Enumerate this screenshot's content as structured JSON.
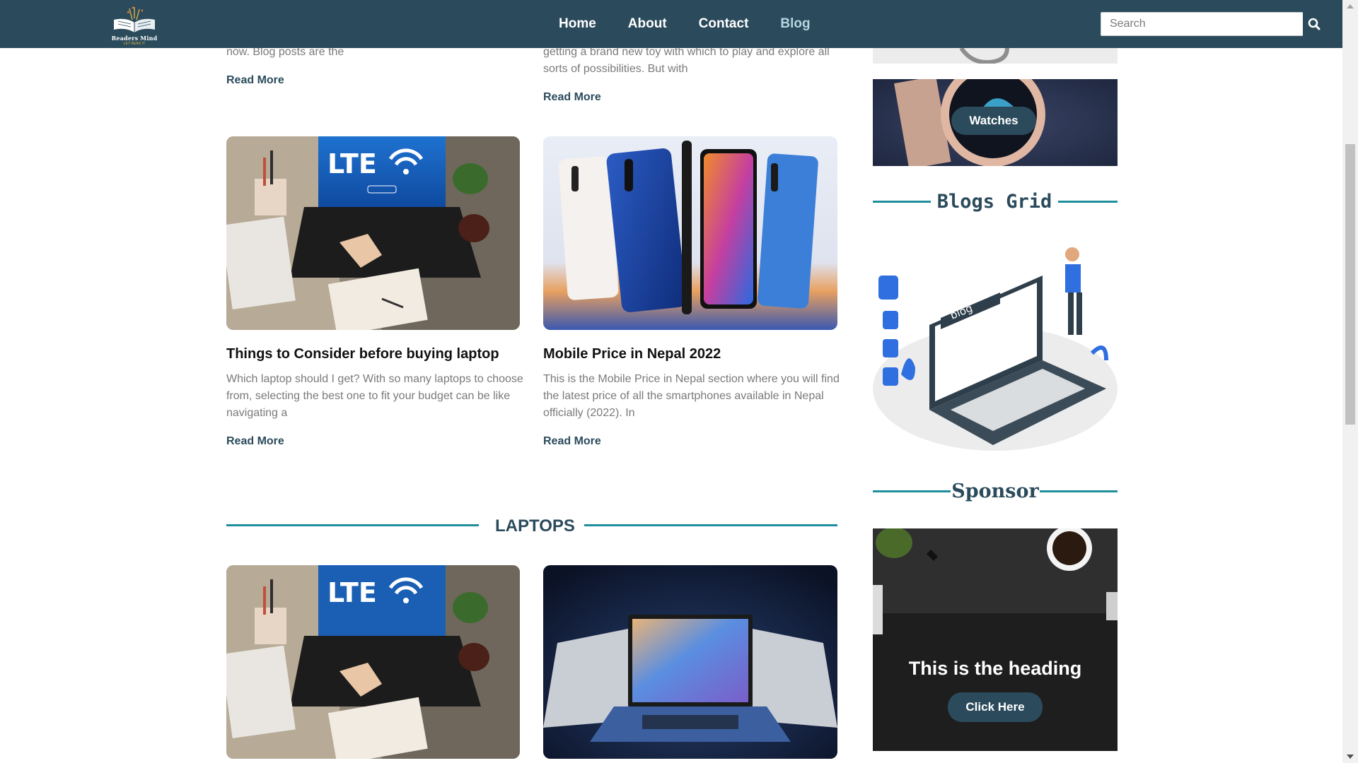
{
  "nav": {
    "logo_text": "Readers Mind",
    "logo_sub": "LET READ IT",
    "links": [
      {
        "label": "Home"
      },
      {
        "label": "About"
      },
      {
        "label": "Contact"
      },
      {
        "label": "Blog"
      }
    ],
    "search_placeholder": "Search"
  },
  "top_posts": [
    {
      "snippet": "now. Blog posts are the",
      "read_more": "Read More"
    },
    {
      "snippet_lines": [
        "getting a brand new toy with which to play and explore all",
        "sorts of possibilities. But with"
      ],
      "read_more": "Read More"
    }
  ],
  "posts": [
    {
      "title": "Things to Consider before buying laptop",
      "snippet_lines": [
        "Which laptop should I get? With so many laptops to choose",
        "from, selecting the best one to fit your budget can be like",
        "navigating a"
      ],
      "read_more": "Read More",
      "image_text": "LTE"
    },
    {
      "title": "Mobile Price in Nepal 2022",
      "snippet_lines": [
        "This is the Mobile Price in Nepal section where you will find",
        "the latest price of all the smartphones available in Nepal",
        "officially (2022). In"
      ],
      "read_more": "Read More"
    }
  ],
  "laptops_section": {
    "title": "LAPTOPS",
    "image_text": "LTE"
  },
  "sidebar": {
    "watches_label": "Watches",
    "blogs_grid_title": "Blogs Grid",
    "blog_illustration_text": "blog",
    "sponsor_title": "Sponsor",
    "sponsor_heading": "This is the heading",
    "sponsor_button": "Click Here"
  },
  "colors": {
    "navbar": "#2b4b5c",
    "accent_line": "#1f8e9c",
    "heading": "#2b4b5c"
  }
}
